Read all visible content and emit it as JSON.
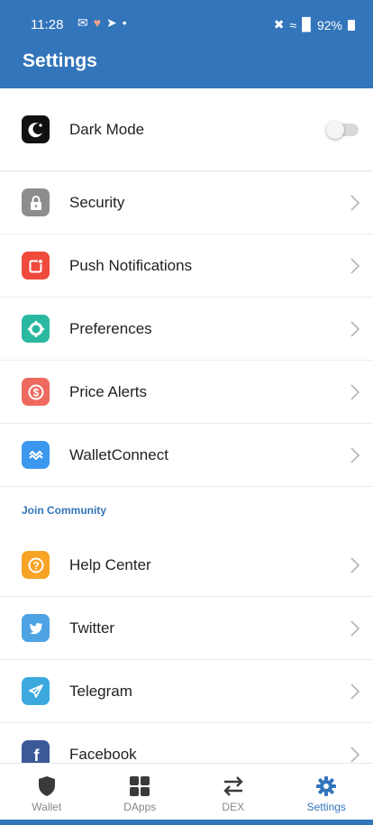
{
  "status_bar": {
    "time": "11:28",
    "left_icons": [
      "gmail-icon",
      "heart-icon",
      "telegram-icon",
      "dot-icon"
    ],
    "right_icons": [
      "mute-icon",
      "wifi-icon",
      "volte-icon",
      "signal-icon"
    ],
    "battery": "92%"
  },
  "header": {
    "title": "Settings",
    "color": "#3375bb"
  },
  "dark_mode": {
    "label": "Dark Mode",
    "enabled": false
  },
  "items": [
    {
      "label": "Security",
      "icon": "lock-icon",
      "color": "#8d8d8d"
    },
    {
      "label": "Push Notifications",
      "icon": "notification-icon",
      "color": "#ef4a3c"
    },
    {
      "label": "Preferences",
      "icon": "gear-icon",
      "color": "#2bb8a0"
    },
    {
      "label": "Price Alerts",
      "icon": "dollar-icon",
      "color": "#ee6a5f"
    },
    {
      "label": "WalletConnect",
      "icon": "walletconnect-icon",
      "color": "#3c97ef"
    }
  ],
  "community": {
    "title": "Join Community",
    "items": [
      {
        "label": "Help Center",
        "icon": "help-icon",
        "color": "#f7a325"
      },
      {
        "label": "Twitter",
        "icon": "twitter-icon",
        "color": "#4da3e3"
      },
      {
        "label": "Telegram",
        "icon": "telegram-icon",
        "color": "#3ba9de"
      },
      {
        "label": "Facebook",
        "icon": "facebook-icon",
        "color": "#3b5998"
      }
    ]
  },
  "tabs": [
    {
      "label": "Wallet",
      "icon": "shield-icon",
      "active": false
    },
    {
      "label": "DApps",
      "icon": "grid-icon",
      "active": false
    },
    {
      "label": "DEX",
      "icon": "swap-icon",
      "active": false
    },
    {
      "label": "Settings",
      "icon": "gear-icon",
      "active": true
    }
  ]
}
